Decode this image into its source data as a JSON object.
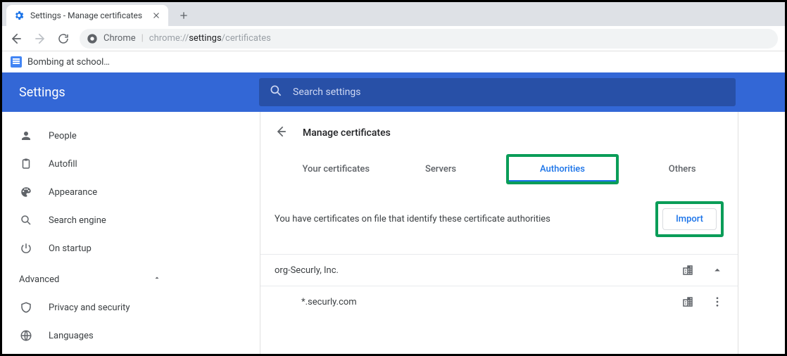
{
  "browser": {
    "tab_title": "Settings - Manage certificates",
    "omnibox": {
      "product": "Chrome",
      "prefix": "chrome://",
      "strong": "settings",
      "suffix": "/certificates"
    },
    "bookmark": "Bombing at school…"
  },
  "settings": {
    "title": "Settings",
    "search_placeholder": "Search settings",
    "sidebar": {
      "items": [
        {
          "label": "People"
        },
        {
          "label": "Autofill"
        },
        {
          "label": "Appearance"
        },
        {
          "label": "Search engine"
        },
        {
          "label": "On startup"
        }
      ],
      "advanced_label": "Advanced",
      "advanced_items": [
        {
          "label": "Privacy and security"
        },
        {
          "label": "Languages"
        }
      ]
    }
  },
  "page": {
    "title": "Manage certificates",
    "tabs": {
      "your": "Your certificates",
      "servers": "Servers",
      "authorities": "Authorities",
      "others": "Others"
    },
    "description": "You have certificates on file that identify these certificate authorities",
    "import_label": "Import",
    "cert_group": "org-Securly, Inc.",
    "cert_item": "*.securly.com"
  }
}
